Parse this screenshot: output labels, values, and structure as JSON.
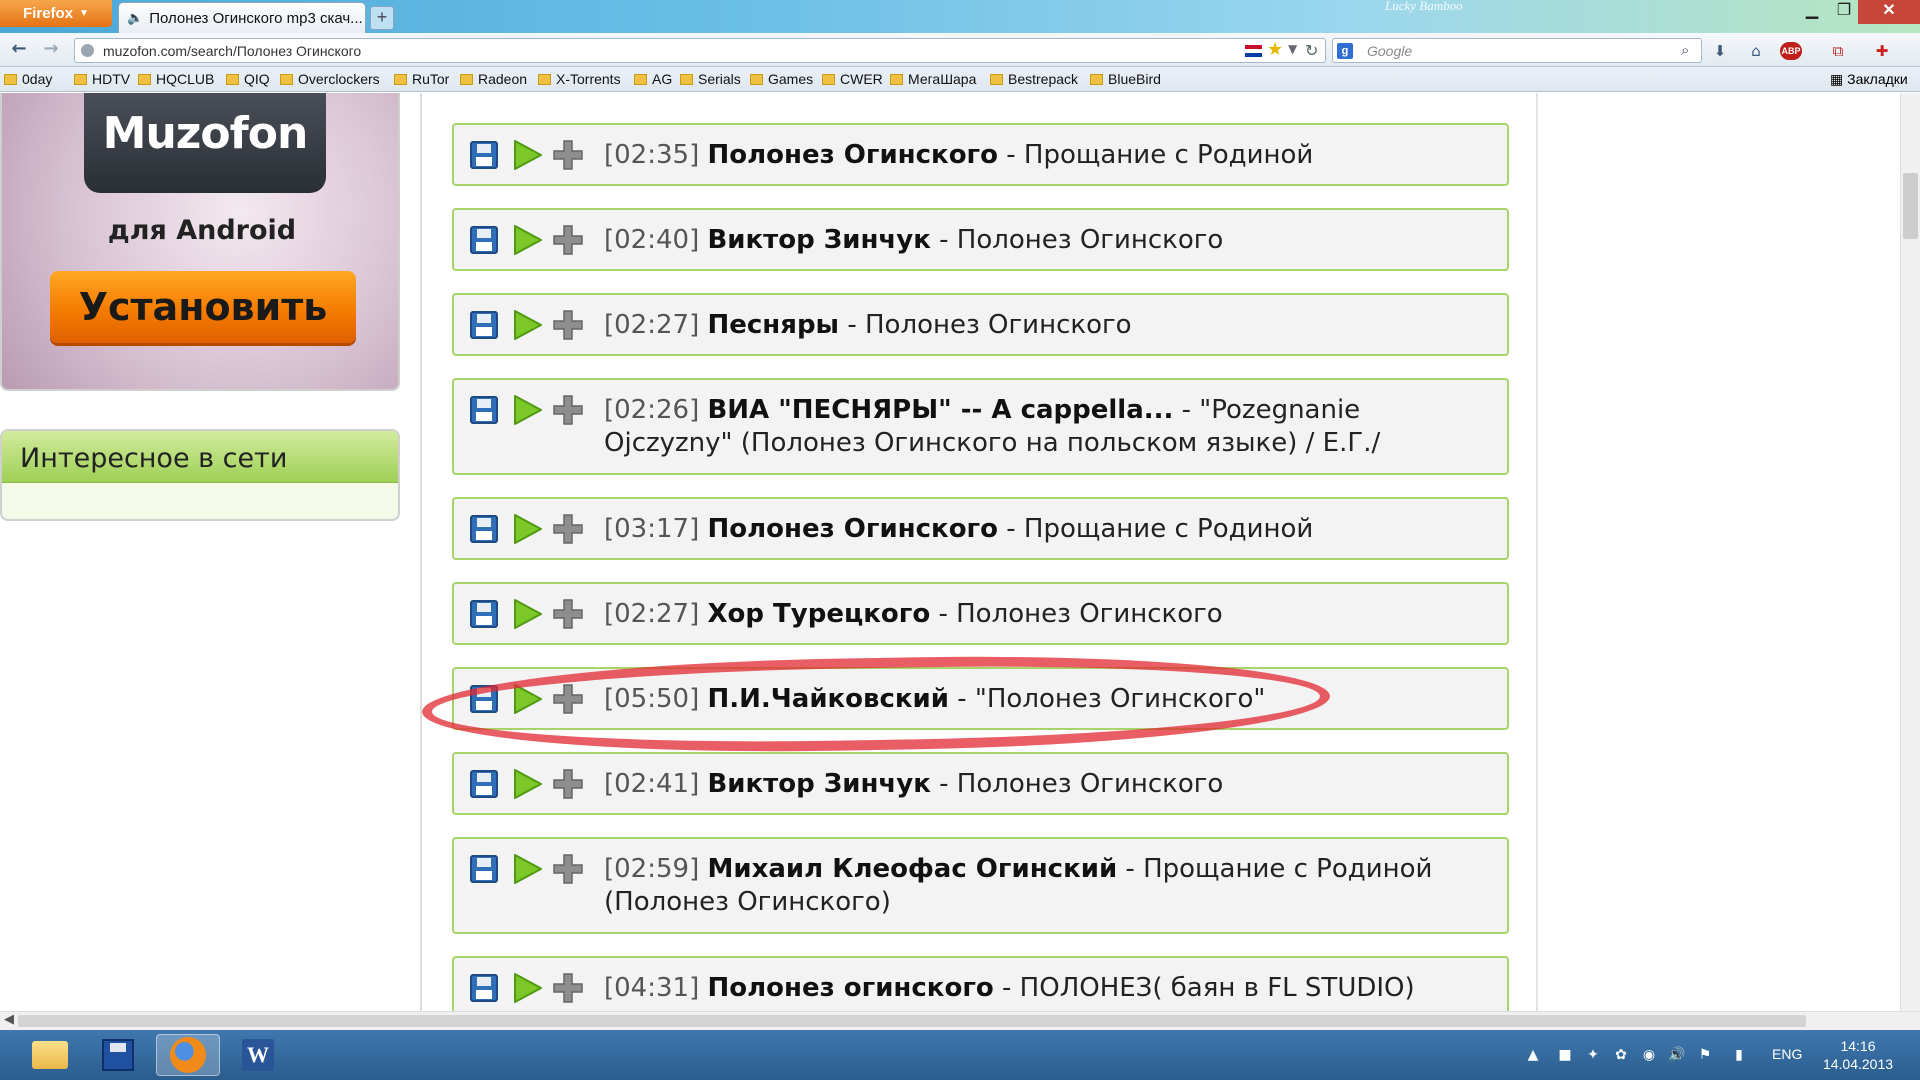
{
  "browser": {
    "menu_button": "Firefox",
    "tab_title": "Полонез Огинского mp3 скач...",
    "new_tab": "+",
    "theme_text": "Lucky Bamboo",
    "url": "muzofon.com/search/Полонез Огинского",
    "search_placeholder": "Google",
    "search_engine_letter": "g",
    "abp_label": "ABP",
    "bookmarks": [
      "0day",
      "HDTV",
      "HQCLUB",
      "QIQ",
      "Overclockers",
      "RuTor",
      "Radeon",
      "X-Torrents",
      "AG",
      "Serials",
      "Games",
      "CWER",
      "МегаШара",
      "Bestrepack",
      "BlueBird"
    ],
    "bookmarks_menu": "Закладки"
  },
  "sidebar": {
    "promo_logo": "Muzofon",
    "promo_subtitle": "для Android",
    "promo_button": "Установить",
    "interesting_title": "Интересное в сети"
  },
  "tracks": [
    {
      "duration": "[02:35]",
      "artist": "Полонез Огинского",
      "title": " - Прощание с Родиной"
    },
    {
      "duration": "[02:40]",
      "artist": "Виктор Зинчук",
      "title": " - Полонез Огинского"
    },
    {
      "duration": "[02:27]",
      "artist": "Песняры",
      "title": " - Полонез Огинского"
    },
    {
      "duration": "[02:26]",
      "artist": "ВИА \"ПЕСНЯРЫ\" -- A cappella...",
      "title": " - \"Pozegnanie Ojczyzny\" (Полонез Огинского на польском языке) / Е.Г./"
    },
    {
      "duration": "[03:17]",
      "artist": "Полонез Огинского",
      "title": " - Прощание с Родиной"
    },
    {
      "duration": "[02:27]",
      "artist": "Хор Турецкого",
      "title": " - Полонез Огинского"
    },
    {
      "duration": "[05:50]",
      "artist": "П.И.Чайковский",
      "title": " - \"Полонез Огинского\""
    },
    {
      "duration": "[02:41]",
      "artist": "Виктор Зинчук",
      "title": " - Полонез Огинского"
    },
    {
      "duration": "[02:59]",
      "artist": "Михаил Клеофас Огинский",
      "title": " - Прощание с Родиной (Полонез Огинского)"
    },
    {
      "duration": "[04:31]",
      "artist": "Полонез огинского",
      "title": " - ПОЛОНЕЗ( баян в FL STUDIO)"
    }
  ],
  "taskbar": {
    "word_letter": "W",
    "language": "ENG",
    "time": "14:16",
    "date": "14.04.2013"
  },
  "colors": {
    "track_border": "#a8d46a",
    "highlight": "#e12832",
    "install_button": "#f57c00"
  }
}
